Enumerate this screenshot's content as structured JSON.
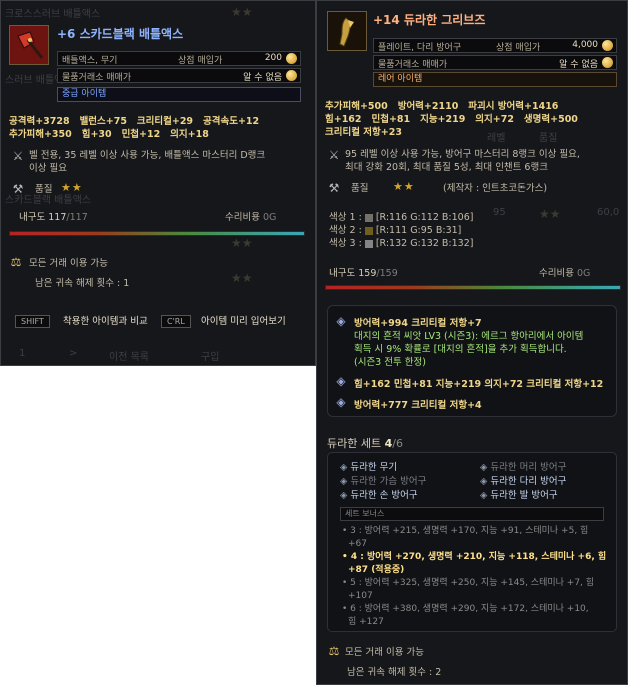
{
  "left": {
    "title": "+6 스카드블랙 배틀액스",
    "title_color": "#8fb4ff",
    "type_line": "배틀액스, 무기",
    "shop_label": "상점 매입가",
    "shop_value": "200",
    "market_label": "물품거래소 매매가",
    "market_value": "알 수 없음",
    "grade": "중급 아이템",
    "grade_color": "#7ba6ff",
    "stats_line1": [
      "공격력+3728",
      "밸런스+75",
      "크리티컬+29",
      "공격속도+12"
    ],
    "stats_line2": [
      "추가피해+350",
      "힘+30",
      "민첩+12",
      "의지+18"
    ],
    "desc_line1": "벨 전용, 35 레벨 이상 사용 가능, 배틀액스 마스터리 D랭크",
    "desc_line2": "이상 필요",
    "quality_label": "품질",
    "quality_stars": "★★",
    "durability_label": "내구도",
    "durability_value": "117",
    "durability_max": "/117",
    "durability_fraction": 1.0,
    "repair_label": "수리비용",
    "repair_value": "0G",
    "trade_label": "모든 거래 이용 가능",
    "unbind_text": "남은 귀속 해제 횟수 : 1",
    "shift_key": "SHIFT",
    "shift_action": "착용한 아이템과 비교",
    "ctrl_key": "C'RL",
    "ctrl_action": "아이템 미리 입어보기",
    "bg_list": [
      "크로스스러브 배틀액스",
      "스러브 배틀액스",
      "스카드블랙 배틀액스"
    ],
    "bg_footer": [
      "1",
      ">",
      "이전 목록",
      "구입"
    ]
  },
  "right": {
    "title": "+14 듀라한 그리브즈",
    "title_color": "#ffb080",
    "type_line": "플레이트, 다리 방어구",
    "shop_label": "상점 매입가",
    "shop_value": "4,000",
    "market_label": "물품거래소 매매가",
    "market_value": "알 수 없음",
    "grade": "레어 아이템",
    "grade_color": "#ffb060",
    "stats_line1": [
      "추가피해+500",
      "방어력+2110",
      "파괴시 방어력+1416"
    ],
    "stats_line2": [
      "힘+162",
      "민첩+81",
      "지능+219",
      "의지+72",
      "생명력+500"
    ],
    "stats_line3": [
      "크리티컬 저항+23"
    ],
    "desc_line1": "95 레벨 이상 사용 가능, 방어구 마스터리 8랭크 이상 필요,",
    "desc_line2": "최대 강화 20회, 최대 품질 5성, 최대 인챈트 6랭크",
    "quality_label": "품질",
    "quality_stars": "★★",
    "maker": "(제작자 : 인트초코돈가스)",
    "colors": [
      {
        "label": "색상 1 :",
        "value": "[R:116 G:112 B:106]",
        "hex": "#74706a"
      },
      {
        "label": "색상 2 :",
        "value": "[R:111 G:95 B:31]",
        "hex": "#6f5f1f"
      },
      {
        "label": "색상 3 :",
        "value": "[R:132 G:132 B:132]",
        "hex": "#848484"
      }
    ],
    "durability_label": "내구도",
    "durability_value": "159",
    "durability_max": "/159",
    "durability_fraction": 1.0,
    "repair_label": "수리비용",
    "repair_value": "0G",
    "gem1_title": "방어력+994  크리티컬 저항+7",
    "gem1_desc1": "대지의 흔적 씨앗 LV3 (시즌3): 에르그 항아리에서 아이템",
    "gem1_desc2": "획득 시 9% 확률로 [대지의 흔적]을 추가 획득합니다.",
    "gem1_desc3": "(시즌3 전투 한정)",
    "gem2": "힘+162  민첩+81  지능+219  의지+72  크리티컬 저항+12",
    "gem3": "방어력+777  크리티컬 저항+4",
    "set_title": "듀라한 세트",
    "set_count": "4",
    "set_total": "/6",
    "set_items": [
      {
        "label": "듀라한 무기",
        "active": true
      },
      {
        "label": "듀라한 머리 방어구",
        "active": false
      },
      {
        "label": "듀라한 가슴 방어구",
        "active": false
      },
      {
        "label": "듀라한 다리 방어구",
        "active": true
      },
      {
        "label": "듀라한 손 방어구",
        "active": true
      },
      {
        "label": "듀라한 발 방어구",
        "active": true
      }
    ],
    "set_bonus_header": "세트 보너스",
    "bonus_lines": [
      {
        "text": "• 3 : 방어력 +215, 생명력 +170, 지능 +91, 스테미나 +5, 힘",
        "cont": "+67",
        "active": false
      },
      {
        "text": "• 4 : 방어력 +270, 생명력 +210, 지능 +118, 스테미나 +6, 힘",
        "cont": "+87 (적용중)",
        "active": true
      },
      {
        "text": "• 5 : 방어력 +325, 생명력 +250, 지능 +145, 스테미나 +7, 힘",
        "cont": "+107",
        "active": false
      },
      {
        "text": "• 6 : 방어력 +380, 생명력 +290, 지능 +172, 스테미나 +10,",
        "cont": "힘 +127",
        "active": false
      }
    ],
    "trade_label": "모든 거래 이용 가능",
    "unbind_text": "남은 귀속 해제 횟수 : 2",
    "bg_text": [
      "레벨",
      "품질",
      "95",
      "★★",
      "60,0"
    ]
  },
  "colors": {
    "panel_bg": "#16171a",
    "border": "#3a3d42",
    "stat_gold": "#f0d68a",
    "star_gold": "#d4a52c",
    "set_active": "#c6d6ef",
    "set_inactive": "#7b7f86"
  }
}
